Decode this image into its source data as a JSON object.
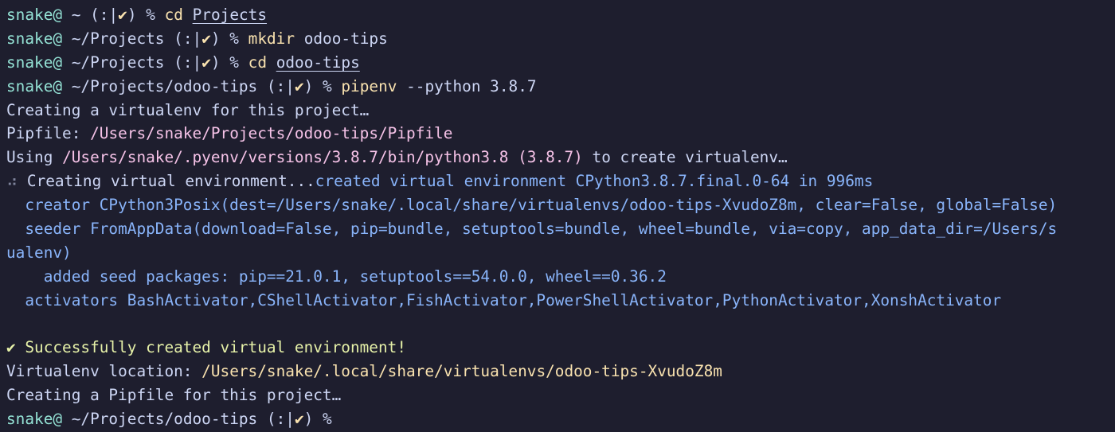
{
  "colors": {
    "background": "#1e1e2e",
    "text": "#cdd6f4",
    "prompt_user": "#94e2d5",
    "command": "#f9e2af",
    "path_pink": "#f5c2e7",
    "dim": "#7f849c",
    "info_blue": "#89b4fa",
    "success": "#e6f1a8"
  },
  "prompt": {
    "user": "snake@",
    "status_open": "(:|",
    "check": "✔",
    "status_close": ")",
    "symbol": "%"
  },
  "lines": {
    "l1": {
      "path": "~",
      "cmd": "cd",
      "arg": "Projects"
    },
    "l2": {
      "path": "~/Projects",
      "cmd": "mkdir",
      "arg": "odoo-tips"
    },
    "l3": {
      "path": "~/Projects",
      "cmd": "cd",
      "arg": "odoo-tips"
    },
    "l4": {
      "path": "~/Projects/odoo-tips",
      "cmd": "pipenv",
      "arg": "--python 3.8.7"
    },
    "l5": {
      "text": "Creating a virtualenv for this project…"
    },
    "l6": {
      "label": "Pipfile:",
      "path": "/Users/snake/Projects/odoo-tips/Pipfile"
    },
    "l7": {
      "prefix": "Using",
      "path": "/Users/snake/.pyenv/versions/3.8.7/bin/python3.8",
      "version": "(3.8.7)",
      "suffix": "to create virtualenv…"
    },
    "l8": {
      "spinner": "⠴",
      "text": "Creating virtual environment...",
      "info": "created virtual environment CPython3.8.7.final.0-64 in 996ms"
    },
    "l9": {
      "text": "  creator CPython3Posix(dest=/Users/snake/.local/share/virtualenvs/odoo-tips-XvudoZ8m, clear=False, global=False)"
    },
    "l10": {
      "text": "  seeder FromAppData(download=False, pip=bundle, setuptools=bundle, wheel=bundle, via=copy, app_data_dir=/Users/s"
    },
    "l11": {
      "text": "ualenv)"
    },
    "l12": {
      "text": "    added seed packages: pip==21.0.1, setuptools==54.0.0, wheel==0.36.2"
    },
    "l13": {
      "text": "  activators BashActivator,CShellActivator,FishActivator,PowerShellActivator,PythonActivator,XonshActivator"
    },
    "l15": {
      "text": "✔ Successfully created virtual environment!"
    },
    "l16": {
      "label": "Virtualenv location:",
      "path": "/Users/snake/.local/share/virtualenvs/odoo-tips-XvudoZ8m"
    },
    "l17": {
      "text": "Creating a Pipfile for this project…"
    },
    "l18": {
      "path": "~/Projects/odoo-tips"
    }
  }
}
